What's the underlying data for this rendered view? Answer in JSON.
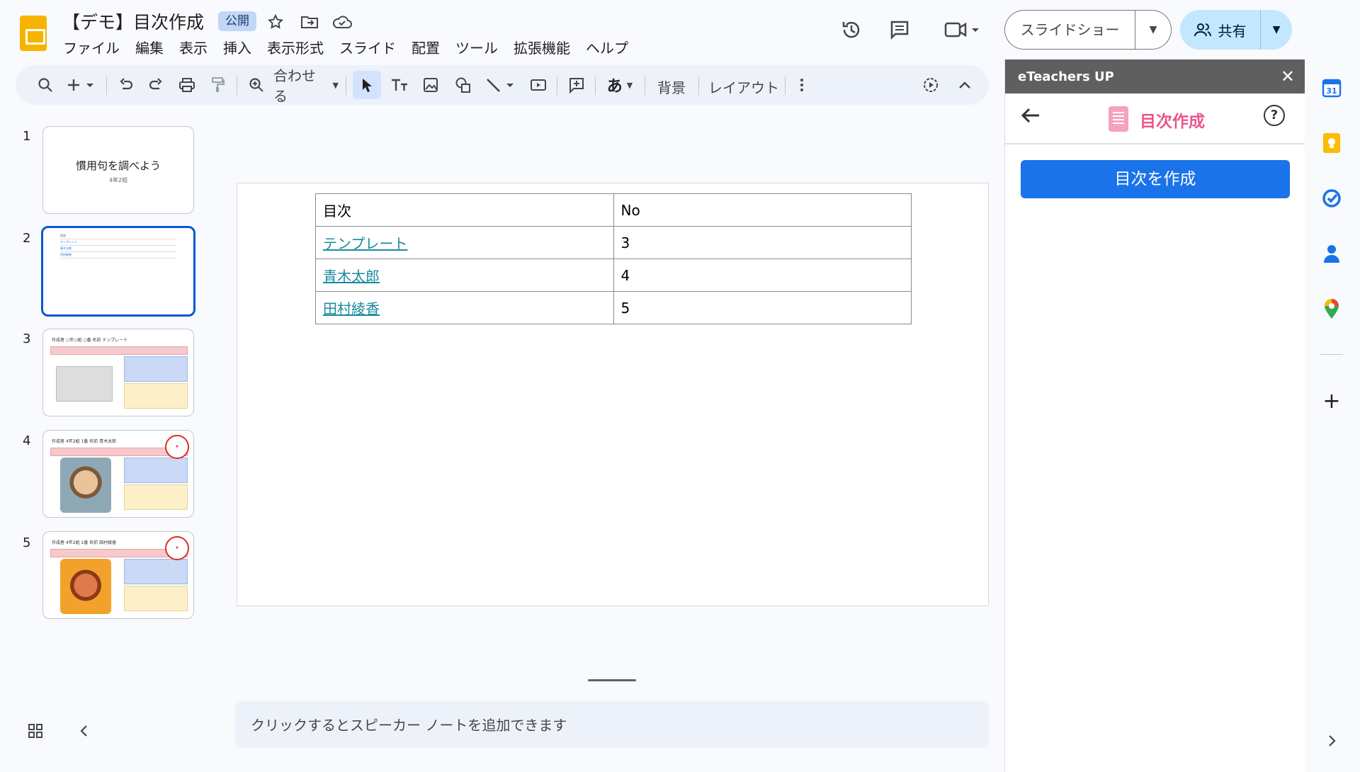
{
  "app": {
    "title": "【デモ】目次作成",
    "badge": "公開"
  },
  "menu": [
    "ファイル",
    "編集",
    "表示",
    "挿入",
    "表示形式",
    "スライド",
    "配置",
    "ツール",
    "拡張機能",
    "ヘルプ"
  ],
  "header": {
    "slideshow_label": "スライドショー",
    "share_label": "共有"
  },
  "toolbar": {
    "zoom_label": "合わせる",
    "text_glyph": "あ",
    "background_label": "背景",
    "layout_label": "レイアウト"
  },
  "slides": [
    {
      "number": "1",
      "title": "慣用句を調べよう",
      "subtitle": "4年2組"
    },
    {
      "number": "2",
      "mini_rows": [
        "目次",
        "テンプレート",
        "青木太郎",
        "田村綾香"
      ]
    },
    {
      "number": "3",
      "heading": "作成者 ○年○組 ○番 名前 テンプレート"
    },
    {
      "number": "4",
      "heading": "作成者 4年2組 1番 名前 青木太郎",
      "stamp": "がんばりました"
    },
    {
      "number": "5",
      "heading": "作成者 4年2組 1番 名前 田村綾香",
      "stamp": "たいへんよくできました"
    }
  ],
  "toc_table": {
    "header": [
      "目次",
      "No"
    ],
    "rows": [
      {
        "title": "テンプレート",
        "no": "3"
      },
      {
        "title": "青木太郎",
        "no": "4"
      },
      {
        "title": "田村綾香",
        "no": "5"
      }
    ]
  },
  "notes_placeholder": "クリックするとスピーカー ノートを追加できます",
  "panel": {
    "header_title": "eTeachers UP",
    "nav_title": "目次作成",
    "create_button": "目次を作成"
  },
  "colors": {
    "accent": "#0b57d0",
    "share_bg": "#c2e7ff",
    "panel_button": "#1a73e8",
    "panel_title": "#e8578d",
    "link": "#1a8a9e"
  }
}
